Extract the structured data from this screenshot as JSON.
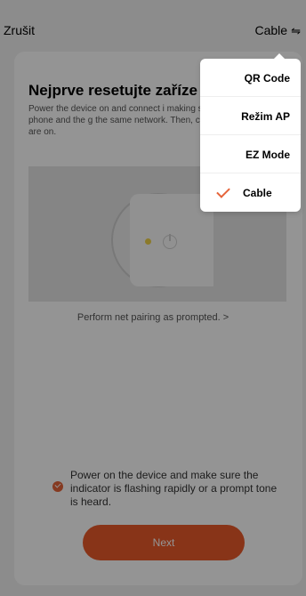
{
  "topbar": {
    "cancel_label": "Zrušit",
    "mode_label": "Cable",
    "mode_icon": "swap-icon"
  },
  "card": {
    "title": "Nejprve resetujte zaříze",
    "description": "Power the device on and connect i making sure your phone and the g the same network. Then, comfirm are on.",
    "prompt_link": "Perform net pairing as prompted. >",
    "confirm_text": "Power on the device and make sure the indicator is flashing rapidly or a prompt tone is heard.",
    "confirm_checked": true,
    "next_label": "Next"
  },
  "menu": {
    "items": [
      {
        "label": "QR Code",
        "selected": false
      },
      {
        "label": "Režim AP",
        "selected": false
      },
      {
        "label": "EZ Mode",
        "selected": false
      },
      {
        "label": "Cable",
        "selected": true
      }
    ]
  },
  "colors": {
    "accent": "#ea5a2a",
    "led": "#f0d24a",
    "overlay": "rgba(0,0,0,0.42)"
  }
}
